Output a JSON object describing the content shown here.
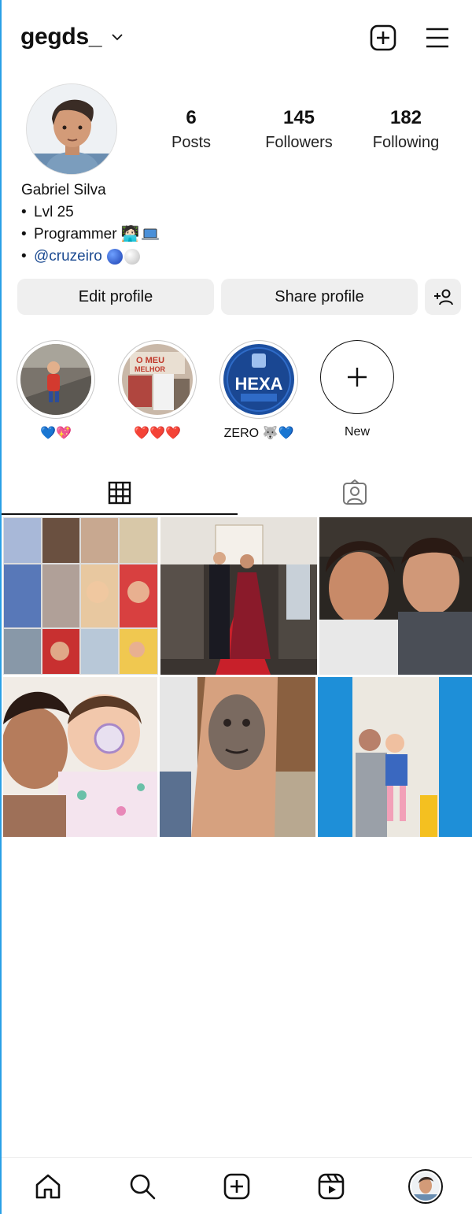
{
  "header": {
    "username": "gegds_",
    "icons": {
      "chevron": "chevron-down-icon",
      "create": "plus-square-icon",
      "menu": "hamburger-menu-icon"
    }
  },
  "profile": {
    "posts_count": "6",
    "posts_label": "Posts",
    "followers_count": "145",
    "followers_label": "Followers",
    "following_count": "182",
    "following_label": "Following",
    "display_name": "Gabriel Silva",
    "bio": [
      {
        "bullet": "•",
        "text": "Lvl 25"
      },
      {
        "bullet": "•",
        "text": "Programmer 🧑🏻‍💻"
      },
      {
        "bullet": "•",
        "text": "@cruzeiro"
      }
    ]
  },
  "actions": {
    "edit_label": "Edit profile",
    "share_label": "Share profile",
    "discover_icon": "add-person-icon"
  },
  "highlights": [
    {
      "label": "💙💖"
    },
    {
      "label": "❤️❤️❤️"
    },
    {
      "label": "ZERO 🐺💙",
      "badge": "HEXA"
    },
    {
      "label": "New"
    }
  ],
  "tabs": {
    "grid_icon": "grid-icon",
    "tagged_icon": "tagged-person-icon"
  },
  "bottom_nav": {
    "home": "home-icon",
    "search": "search-icon",
    "create": "plus-square-icon",
    "reels": "reels-icon",
    "profile": "avatar"
  },
  "colors": {
    "link": "#1b4a91",
    "button_bg": "#efefef",
    "accent_blue": "#2aa0e6",
    "cruzeiro_blue": "#1c4fa0"
  }
}
